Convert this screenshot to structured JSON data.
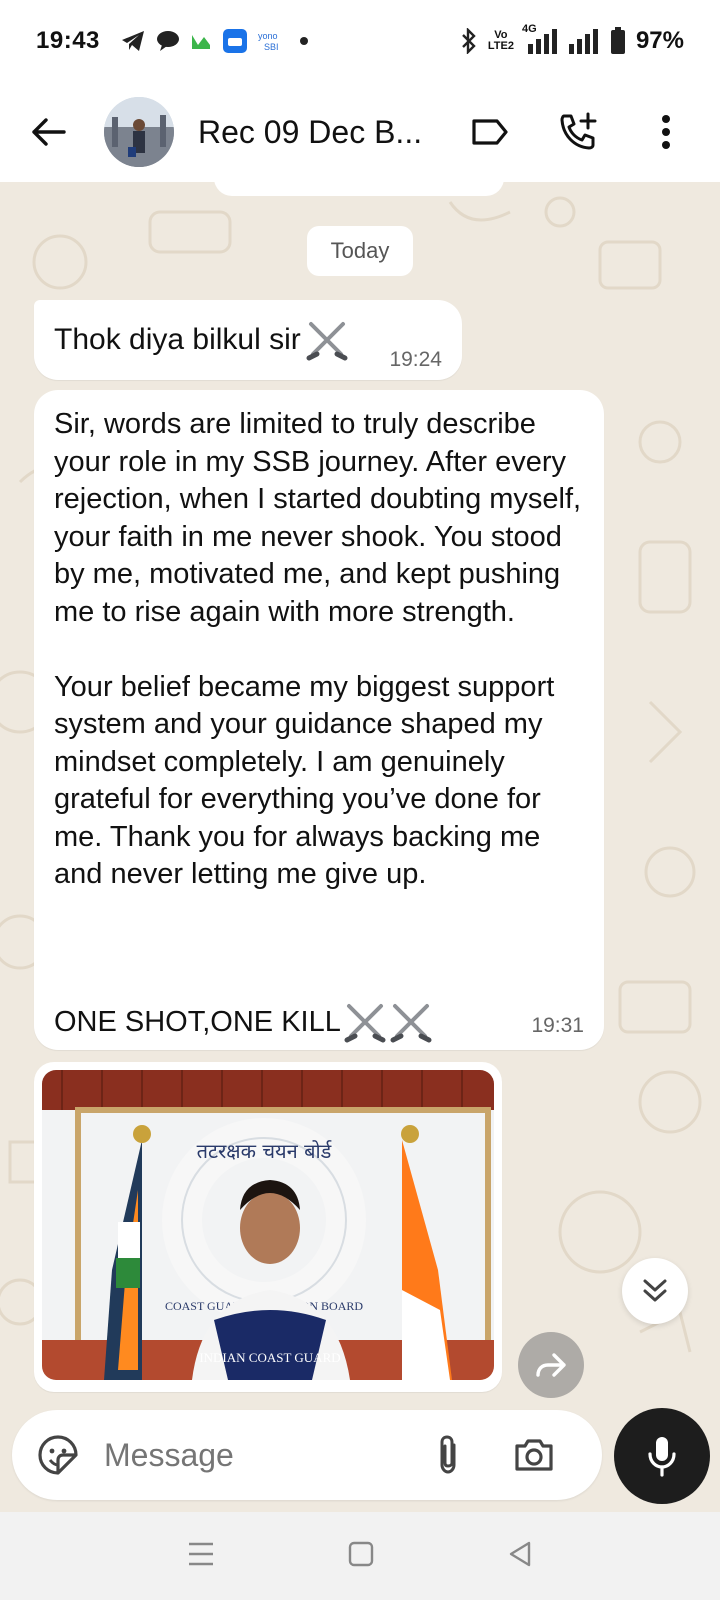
{
  "status_bar": {
    "time": "19:43",
    "network_label_top": "Vo",
    "network_label_bottom": "LTE2",
    "net_type": "4G",
    "battery": "97%"
  },
  "header": {
    "title": "Rec 09 Dec B..."
  },
  "chat": {
    "date_chip": "Today",
    "messages": [
      {
        "text": "Thok diya bilkul sir",
        "time": "19:24",
        "emoji": "crossed-swords"
      },
      {
        "text": "Sir, words are limited to truly describe your role in my SSB journey. After every rejection, when I started doubting myself, your faith in me never shook. You stood by me, motivated me, and kept pushing me to rise again with more strength.\n\nYour belief became my biggest support system and your guidance shaped my mindset completely. I am genuinely grateful for everything you’ve done for me. Thank you for always backing me and never letting me give up.",
        "tail": "ONE SHOT,ONE KILL",
        "time": "19:31"
      }
    ],
    "photo": {
      "sign_text": "तटरक्षक चयन बोर्ड",
      "ring_text": "COAST GUARD SELECTION BOARD",
      "shirt_text": "INDIAN COAST GUARD"
    }
  },
  "composer": {
    "placeholder": "Message"
  },
  "colors": {
    "wallpaper": "#efe9df",
    "bubble": "#ffffff",
    "mic_button": "#1d1d1d"
  }
}
